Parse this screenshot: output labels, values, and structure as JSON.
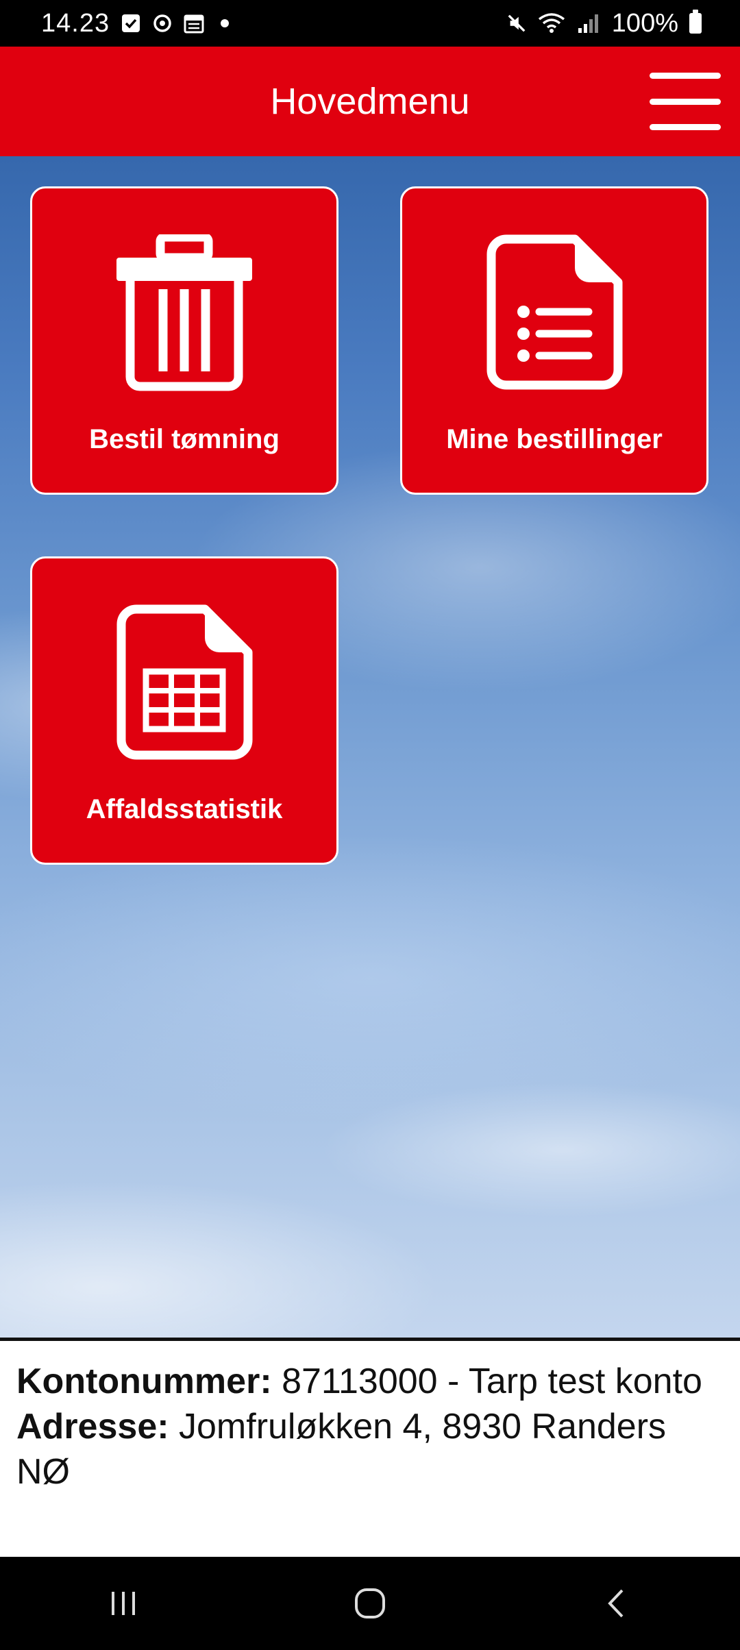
{
  "status_bar": {
    "time": "14.23",
    "battery": "100%",
    "icons": [
      "checkbox-notification-icon",
      "sync-icon",
      "calendar-icon",
      "dot-icon",
      "mute-icon",
      "wifi-icon",
      "signal-icon",
      "battery-icon"
    ]
  },
  "header": {
    "title": "Hovedmenu",
    "menu_icon": "hamburger-menu-icon"
  },
  "tiles": [
    {
      "label": "Bestil tømning",
      "icon": "trash-can-icon"
    },
    {
      "label": "Mine bestillinger",
      "icon": "document-list-icon"
    },
    {
      "label": "Affaldsstatistik",
      "icon": "spreadsheet-document-icon"
    }
  ],
  "account": {
    "account_label": "Kontonummer:",
    "account_value": "87113000 - Tarp test konto",
    "address_label": "Adresse:",
    "address_value": "Jomfruløkken 4, 8930 Randers NØ"
  },
  "nav_bar": {
    "buttons": [
      "recent-apps-icon",
      "home-icon",
      "back-icon"
    ]
  },
  "colors": {
    "brand_red": "#e0000f",
    "sky_blue": "#4a7bc0"
  }
}
